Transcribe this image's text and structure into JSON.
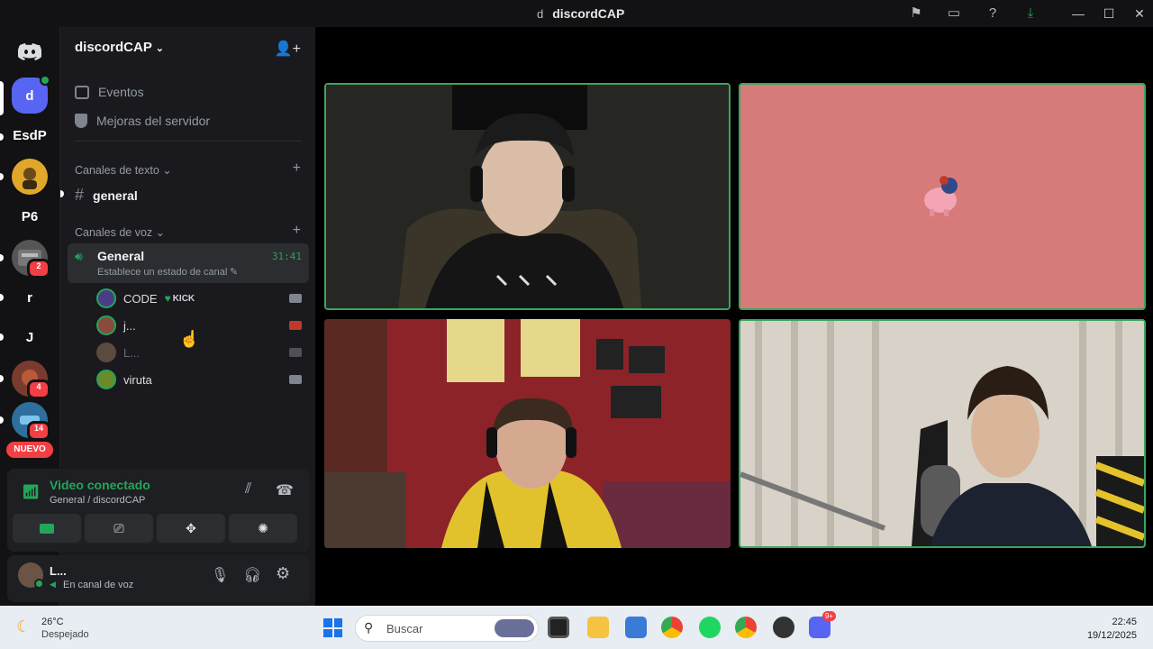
{
  "window": {
    "server_initial": "d",
    "title": "discordCAP"
  },
  "servers": [
    {
      "label": "d",
      "color": "#5865f2"
    },
    {
      "label": "EsdP",
      "color": "#121214"
    },
    {
      "label": "",
      "color": "#e0a72b"
    },
    {
      "label": "P6",
      "color": "#121214"
    },
    {
      "label": "",
      "color": "#555",
      "badge": "2"
    },
    {
      "label": "r",
      "color": "#121214"
    },
    {
      "label": "J",
      "color": "#121214"
    },
    {
      "label": "",
      "color": "#7a3b2e",
      "badge": "4"
    },
    {
      "label": "",
      "color": "#2e6f9e",
      "badge": "14"
    },
    {
      "label": "NUEVO",
      "color": "#f23f43"
    }
  ],
  "sidebar": {
    "server_name": "discordCAP",
    "events": "Eventos",
    "boosts": "Mejoras del servidor",
    "text_category": "Canales de texto",
    "text_channel": "general",
    "voice_category": "Canales de voz",
    "voice_channel": "General",
    "voice_timer": "31:41",
    "voice_status": "Establece un estado de canal",
    "voice_users": [
      {
        "name": "CODE",
        "tag": "KICK",
        "avatar_color": "#4b3c8a"
      },
      {
        "name": "j...",
        "tag": "",
        "avatar_color": "#8a4b3c"
      },
      {
        "name": "L...",
        "tag": "",
        "avatar_color": "#5a4a40"
      },
      {
        "name": "viruta",
        "tag": "",
        "avatar_color": "#6d8a2a"
      }
    ]
  },
  "voice_panel": {
    "status": "Video conectado",
    "channel": "General / discordCAP",
    "user_name": "L...",
    "user_status": "En canal de voz"
  },
  "taskbar": {
    "temperature": "26°C",
    "weather": "Despejado",
    "search_placeholder": "Buscar",
    "time": "22:45",
    "date": "19/12/2025",
    "notif_badge": "9+"
  },
  "colors": {
    "accent_green": "#3ba55c",
    "blurple": "#5865f2",
    "danger": "#f23f43"
  }
}
